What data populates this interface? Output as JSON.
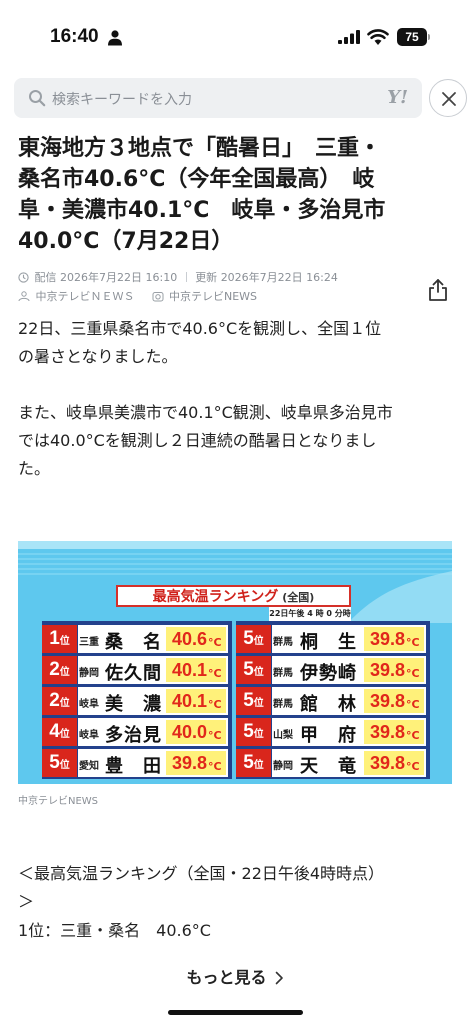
{
  "status_bar": {
    "time": "16:40",
    "battery_level": "75"
  },
  "search": {
    "placeholder": "検索キーワードを入力",
    "logo_text": "Y!"
  },
  "article": {
    "headline_lines": [
      "東海地方３地点で「酷暑日」　三重・",
      "桑名市40.6°C（今年全国最高）　岐",
      "阜・美濃市40.1°C　岐阜・多治見市",
      "40.0°C（7月22日）"
    ],
    "delivered_label": "配信",
    "delivered_time": "2026年7月22日 16:10",
    "updated_label": "更新",
    "updated_time": "2026年7月22日 16:24",
    "source_news": "中京テレビＮＥＷＳ",
    "source_account": "中京テレビNEWS",
    "paragraph1_lines": [
      "22日、三重県桑名市で40.6°Cを観測し、全国１位",
      "の暑さとなりました。"
    ],
    "paragraph2_lines": [
      "また、岐阜県美濃市で40.1°C観測、岐阜県多治見市",
      "では40.0°Cを観測し２日連続の酷暑日となりまし",
      "た。"
    ],
    "image_caption": "中京テレビNEWS",
    "list_heading_lines": [
      "＜最高気温ランキング（全国・22日午後4時時点）",
      "＞"
    ],
    "list_first": "1位：三重・桑名　40.6°C",
    "more_label": "もっと見る"
  },
  "ranking_graphic": {
    "title": "最高気温ランキング",
    "title_sub": "(全国)",
    "time_note": "22日午後 4 時 0 分時点",
    "rank_suffix": "位",
    "unit": "°C",
    "left_rows": [
      {
        "rank": "1",
        "pref": "三重",
        "city": "桑　名",
        "temp": "40.6"
      },
      {
        "rank": "2",
        "pref": "静岡",
        "city": "佐久間",
        "temp": "40.1"
      },
      {
        "rank": "2",
        "pref": "岐阜",
        "city": "美　濃",
        "temp": "40.1"
      },
      {
        "rank": "4",
        "pref": "岐阜",
        "city": "多治見",
        "temp": "40.0"
      },
      {
        "rank": "5",
        "pref": "愛知",
        "city": "豊　田",
        "temp": "39.8"
      }
    ],
    "right_rows": [
      {
        "rank": "5",
        "pref": "群馬",
        "city": "桐　生",
        "temp": "39.8"
      },
      {
        "rank": "5",
        "pref": "群馬",
        "city": "伊勢崎",
        "temp": "39.8"
      },
      {
        "rank": "5",
        "pref": "群馬",
        "city": "館　林",
        "temp": "39.8"
      },
      {
        "rank": "5",
        "pref": "山梨",
        "city": "甲　府",
        "temp": "39.8"
      },
      {
        "rank": "5",
        "pref": "静岡",
        "city": "天　竜",
        "temp": "39.8"
      }
    ]
  },
  "colors": {
    "graphic_sky": "#5ec8ee",
    "graphic_navy": "#23418c",
    "rank_red": "#d9261c",
    "temp_yellow": "#fff17a"
  }
}
